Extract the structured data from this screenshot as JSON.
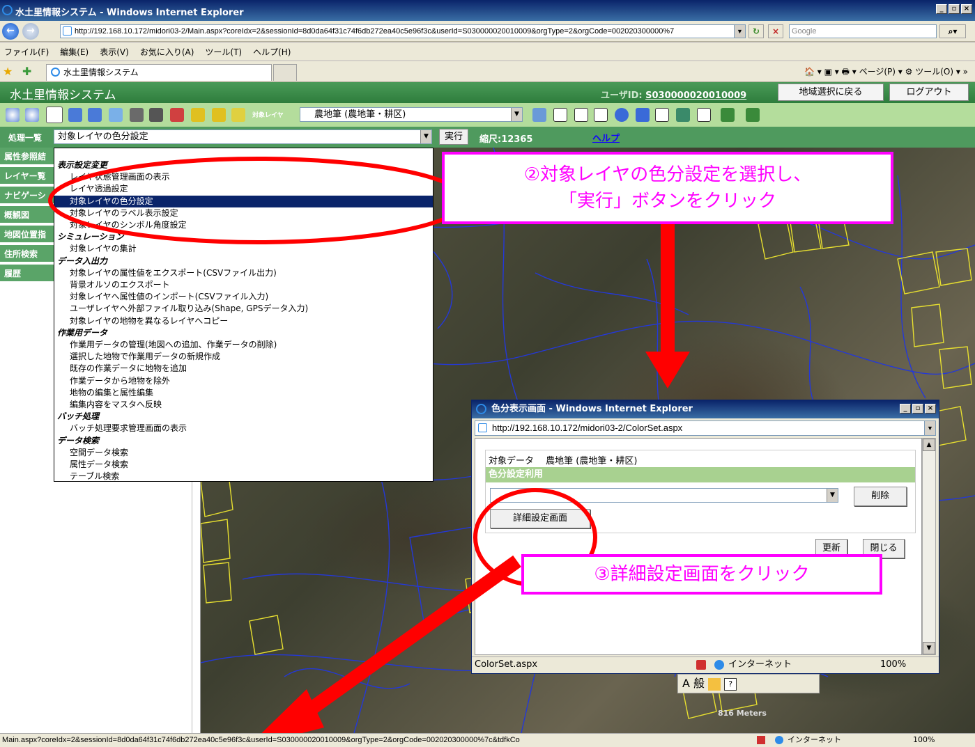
{
  "browser": {
    "title": "水土里情報システム - Windows Internet Explorer",
    "address": "http://192.168.10.172/midori03-2/Main.aspx?coreIdx=2&sessionId=8d0da64f31c74f6db272ea40c5e96f3c&userId=S030000020010009&orgType=2&orgCode=002020300000%7",
    "search_placeholder": "Google",
    "menu": [
      "ファイル(F)",
      "編集(E)",
      "表示(V)",
      "お気に入り(A)",
      "ツール(T)",
      "ヘルプ(H)"
    ],
    "tab_title": "水土里情報システム",
    "command_bar": "🏠 ▾ ▣ ▾ 🖶 ▾ ページ(P) ▾ ⚙ ツール(O) ▾ »",
    "win_buttons": [
      "_",
      "▫",
      "×"
    ],
    "status_url": "Main.aspx?coreIdx=2&sessionId=8d0da64f31c74f6db272ea40c5e96f3c&userId=S030000020010009&orgType=2&orgCode=002020300000%7c&tdfkCo",
    "status_zone": "インターネット",
    "status_zoom": "100%"
  },
  "app": {
    "name": "水土里情報システム",
    "user_label": "ユーザID:",
    "user_id": "S030000020010009",
    "back_button": "地域選択に戻る",
    "logout_button": "ログアウト",
    "layer_label": "対象レイヤ",
    "layer_value": "農地筆 (農地筆・耕区)",
    "process_label": "処理一覧",
    "process_value": "対象レイヤの色分設定",
    "exec_button": "実行",
    "scale_text": "縮尺:12365",
    "help_link": "ヘルプ"
  },
  "sidebar": {
    "tabs": [
      "属性参照結",
      "レイヤー覧",
      "ナビゲーシ",
      "概観図",
      "地図位置指",
      "住所検索",
      "履歴"
    ]
  },
  "dropdown": {
    "items": [
      {
        "text": "表示設定変更",
        "kind": "group"
      },
      {
        "text": "レイヤ状態管理画面の表示",
        "kind": "option"
      },
      {
        "text": "レイヤ透過設定",
        "kind": "option"
      },
      {
        "text": "対象レイヤの色分設定",
        "kind": "selected"
      },
      {
        "text": "対象レイヤのラベル表示設定",
        "kind": "option"
      },
      {
        "text": "対象レイヤのシンボル角度設定",
        "kind": "option"
      },
      {
        "text": "シミュレーション",
        "kind": "group"
      },
      {
        "text": "対象レイヤの集計",
        "kind": "option"
      },
      {
        "text": "データ入出力",
        "kind": "group"
      },
      {
        "text": "対象レイヤの属性値をエクスポート(CSVファイル出力)",
        "kind": "option"
      },
      {
        "text": "背景オルソのエクスポート",
        "kind": "option"
      },
      {
        "text": "対象レイヤへ属性値のインポート(CSVファイル入力)",
        "kind": "option"
      },
      {
        "text": "ユーザレイヤへ外部ファイル取り込み(Shape, GPSデータ入力)",
        "kind": "option"
      },
      {
        "text": "対象レイヤの地物を異なるレイヤへコピー",
        "kind": "option"
      },
      {
        "text": "作業用データ",
        "kind": "group"
      },
      {
        "text": "作業用データの管理(地図への追加、作業データの削除)",
        "kind": "option"
      },
      {
        "text": "選択した地物で作業用データの新規作成",
        "kind": "option"
      },
      {
        "text": "既存の作業データに地物を追加",
        "kind": "option"
      },
      {
        "text": "作業データから地物を除外",
        "kind": "option"
      },
      {
        "text": "地物の編集と属性編集",
        "kind": "option"
      },
      {
        "text": "編集内容をマスタへ反映",
        "kind": "option"
      },
      {
        "text": "バッチ処理",
        "kind": "group"
      },
      {
        "text": "バッチ処理要求管理画面の表示",
        "kind": "option"
      },
      {
        "text": "データ検索",
        "kind": "group"
      },
      {
        "text": "空間データ検索",
        "kind": "option"
      },
      {
        "text": "属性データ検索",
        "kind": "option"
      },
      {
        "text": "テーブル検索",
        "kind": "option"
      }
    ]
  },
  "popup": {
    "title": "色分表示画面 - Windows Internet Explorer",
    "address": "http://192.168.10.172/midori03-2/ColorSet.aspx",
    "target_label": "対象データ　 農地筆 (農地筆・耕区)",
    "section_label": "色分設定利用",
    "delete_button": "削除",
    "detail_button": "詳細設定画面",
    "update_button": "更新",
    "close_button": "閉じる",
    "status_page": "ColorSet.aspx",
    "status_zone": "インターネット",
    "status_zoom": "100%"
  },
  "annotations": {
    "step2_line1": "②対象レイヤの色分設定を選択し、",
    "step2_line2": "「実行」ボタンをクリック",
    "step3": "③詳細設定画面をクリック"
  },
  "ime_bar": "A 般 ",
  "map_scale": "816 Meters"
}
